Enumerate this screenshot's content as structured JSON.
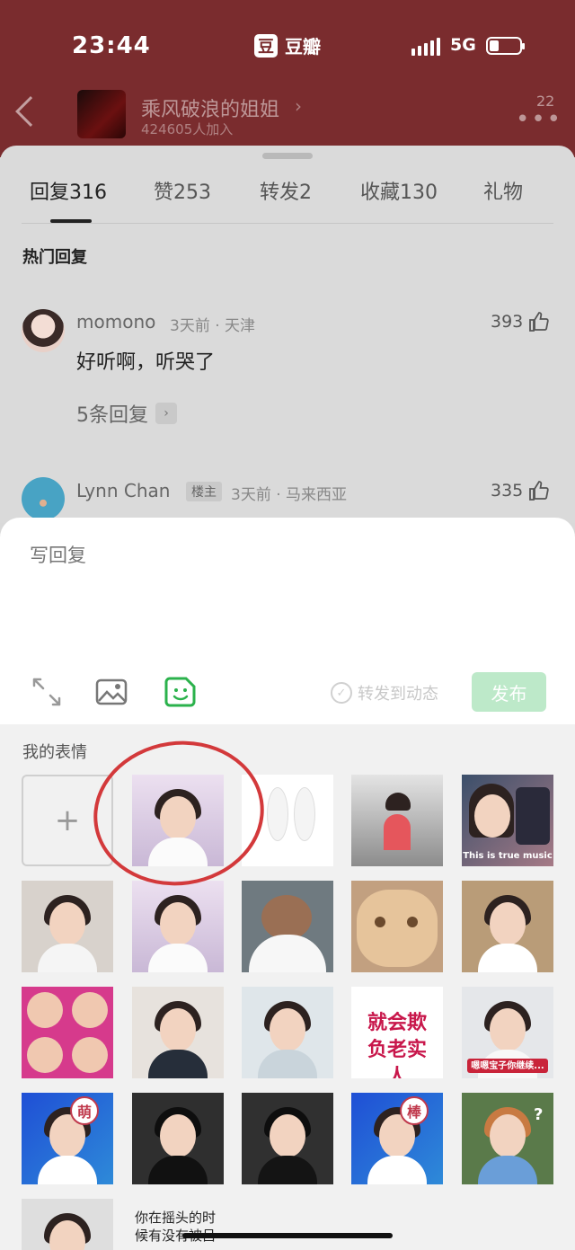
{
  "status_bar": {
    "time": "23:44",
    "app_badge": "豆",
    "app_name": "豆瓣",
    "network": "5G"
  },
  "header": {
    "group_name": "乘风破浪的姐姐",
    "group_count": "424605人加入",
    "more_badge": "22"
  },
  "tabs": [
    {
      "label": "回复",
      "count": "316"
    },
    {
      "label": "赞",
      "count": "253"
    },
    {
      "label": "转发",
      "count": "2"
    },
    {
      "label": "收藏",
      "count": "130"
    },
    {
      "label": "礼物",
      "count": ""
    }
  ],
  "hot_title": "热门回复",
  "comments": [
    {
      "user": "momono",
      "meta": "3天前 · 天津",
      "likes": "393",
      "text": "好听啊，听哭了",
      "replies": "5条回复"
    },
    {
      "user": "Lynn Chan",
      "tag": "楼主",
      "meta": "3天前 · 马来西亚",
      "likes": "335"
    }
  ],
  "compose": {
    "placeholder": "写回复",
    "repost_label": "转发到动态",
    "publish_label": "发布"
  },
  "stickers": {
    "title": "我的表情",
    "add_label": "+",
    "captions": {
      "true_music": "This is true music",
      "bully": "就会欺负老实人",
      "meng": "萌",
      "bang": "棒",
      "xiaobao": "嗯嗯宝子你继续...",
      "question": "?",
      "shaking": "你在摇头的时候有没有被吕"
    }
  },
  "colors": {
    "header_bg": "#7a2c2e",
    "accent_green": "#2bb24c",
    "publish_disabled": "#bde9c9",
    "annotation_red": "#d3393b"
  }
}
